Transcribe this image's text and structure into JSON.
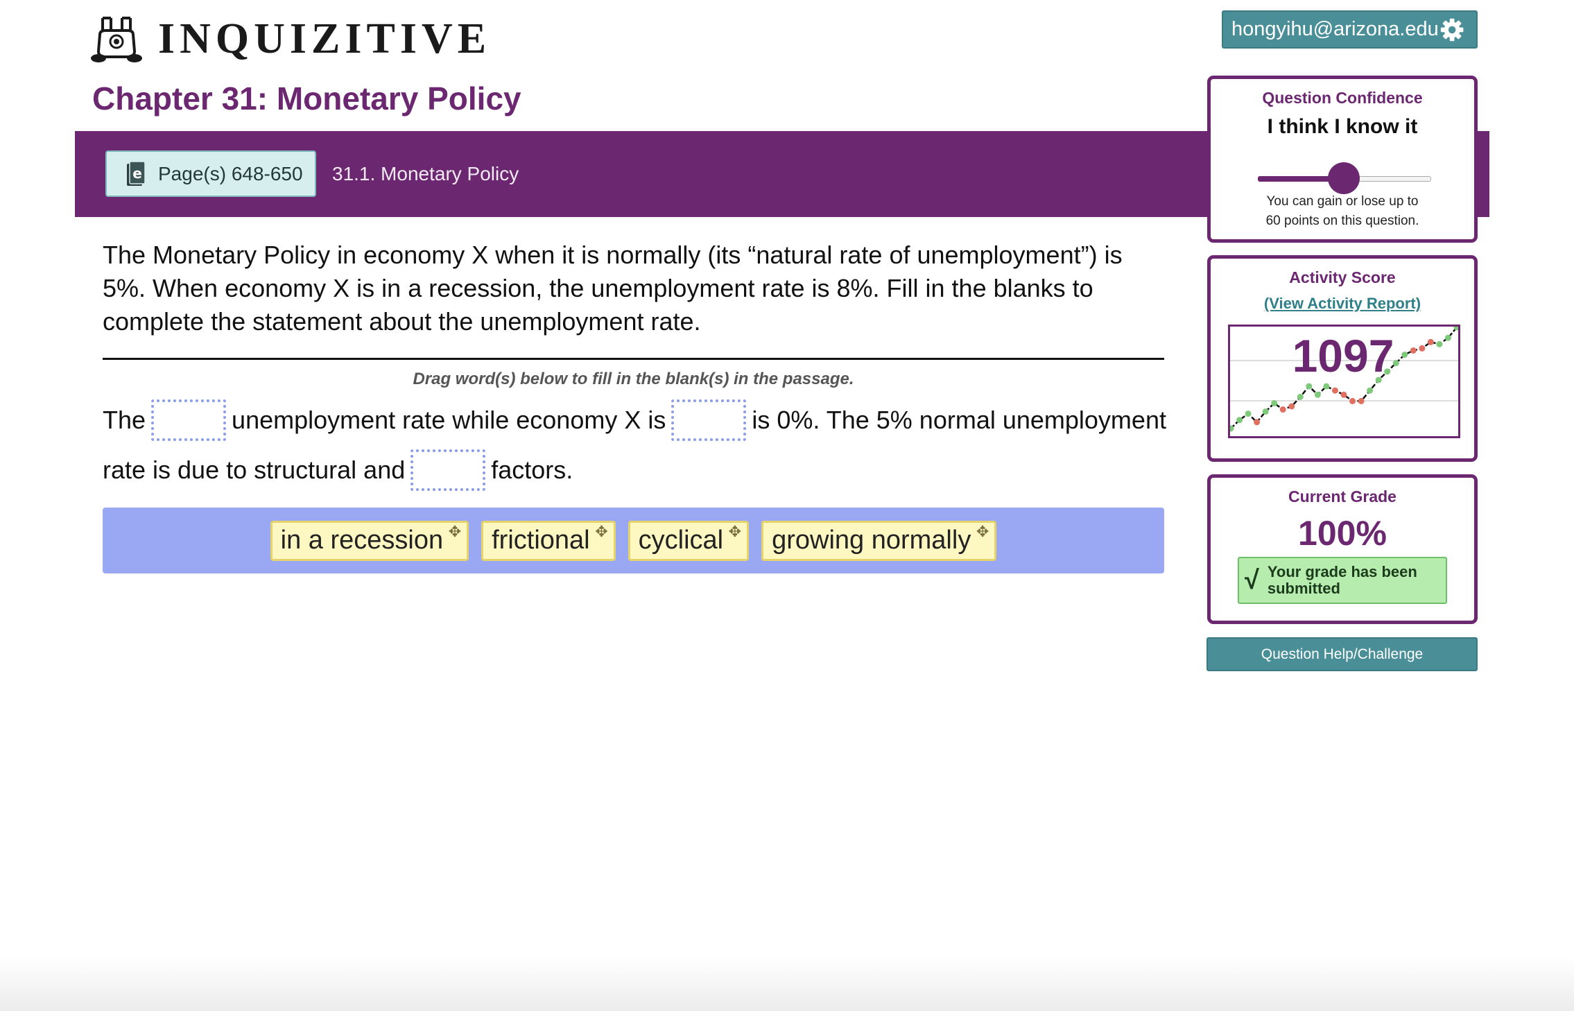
{
  "app": {
    "name": "INQUIZITIVE",
    "logo_icon": "bunny-logo-icon"
  },
  "chapter": {
    "title": "Chapter 31: Monetary Policy"
  },
  "header": {
    "page_button_label": "Page(s) 648-650",
    "page_button_icon": "ebook-icon",
    "section": "31.1. Monetary Policy"
  },
  "question": {
    "text": "The Monetary Policy in economy X when it is normally (its “natural rate of unemployment”) is 5%. When economy X is in a recession, the unemployment rate is 8%. Fill in the blanks to complete the statement about the unemployment rate.",
    "instruction": "Drag word(s) below to fill in the blank(s) in the passage.",
    "passage": {
      "seg1": "The",
      "seg2": "unemployment rate while economy X is",
      "seg3": "is 0%. The 5% normal unemployment",
      "seg4": "rate is due to structural and",
      "seg5": "factors."
    },
    "word_bank": [
      "in a recession",
      "frictional",
      "cyclical",
      "growing normally"
    ],
    "drag_icon": "move-arrows-icon"
  },
  "user": {
    "email": "hongyihu@arizona.edu",
    "settings_icon": "gear-icon"
  },
  "confidence": {
    "title": "Question Confidence",
    "value_label": "I think I know it",
    "slider_level": 0.5,
    "note_line1": "You can gain or lose up to",
    "note_line2": "60 points on this question."
  },
  "activity": {
    "title": "Activity Score",
    "report_link": "(View Activity Report)",
    "score": "1097",
    "trend": [
      {
        "v": 4,
        "c": "g"
      },
      {
        "v": 12,
        "c": "g"
      },
      {
        "v": 18,
        "c": "g"
      },
      {
        "v": 10,
        "c": "r"
      },
      {
        "v": 20,
        "c": "g"
      },
      {
        "v": 28,
        "c": "g"
      },
      {
        "v": 22,
        "c": "r"
      },
      {
        "v": 25,
        "c": "r"
      },
      {
        "v": 34,
        "c": "g"
      },
      {
        "v": 44,
        "c": "g"
      },
      {
        "v": 36,
        "c": "g"
      },
      {
        "v": 44,
        "c": "g"
      },
      {
        "v": 40,
        "c": "r"
      },
      {
        "v": 36,
        "c": "r"
      },
      {
        "v": 30,
        "c": "r"
      },
      {
        "v": 30,
        "c": "r"
      },
      {
        "v": 40,
        "c": "g"
      },
      {
        "v": 50,
        "c": "g"
      },
      {
        "v": 58,
        "c": "g"
      },
      {
        "v": 66,
        "c": "g"
      },
      {
        "v": 74,
        "c": "g"
      },
      {
        "v": 78,
        "c": "r"
      },
      {
        "v": 80,
        "c": "r"
      },
      {
        "v": 86,
        "c": "r"
      },
      {
        "v": 84,
        "c": "g"
      },
      {
        "v": 90,
        "c": "g"
      },
      {
        "v": 100,
        "c": "g"
      }
    ]
  },
  "grade": {
    "title": "Current Grade",
    "value": "100%",
    "status_line1": "Your grade has been",
    "status_line2": "submitted",
    "check_icon": "check-icon"
  },
  "help_button": "Question Help/Challenge",
  "colors": {
    "brand_purple": "#6b2770",
    "teal": "#4a8f97",
    "word_bank_bg": "#9aa8f3",
    "chip_bg": "#fdf7c2",
    "success_bg": "#b6ecae",
    "trend_green": "#7fc97a",
    "trend_red": "#e0705f"
  }
}
